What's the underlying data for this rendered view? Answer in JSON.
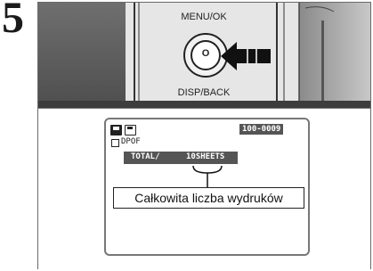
{
  "step": {
    "number": "5"
  },
  "buttons": {
    "menu_ok_label": "MENU/OK",
    "disp_back_label": "DISP/BACK",
    "center_label": "O"
  },
  "lcd": {
    "frame_counter": "100-0009",
    "dpof_label": "DPOF",
    "total_label": "TOTAL/",
    "total_value": "10SHEETS"
  },
  "callout": {
    "text": "Całkowita liczba wydruków"
  }
}
